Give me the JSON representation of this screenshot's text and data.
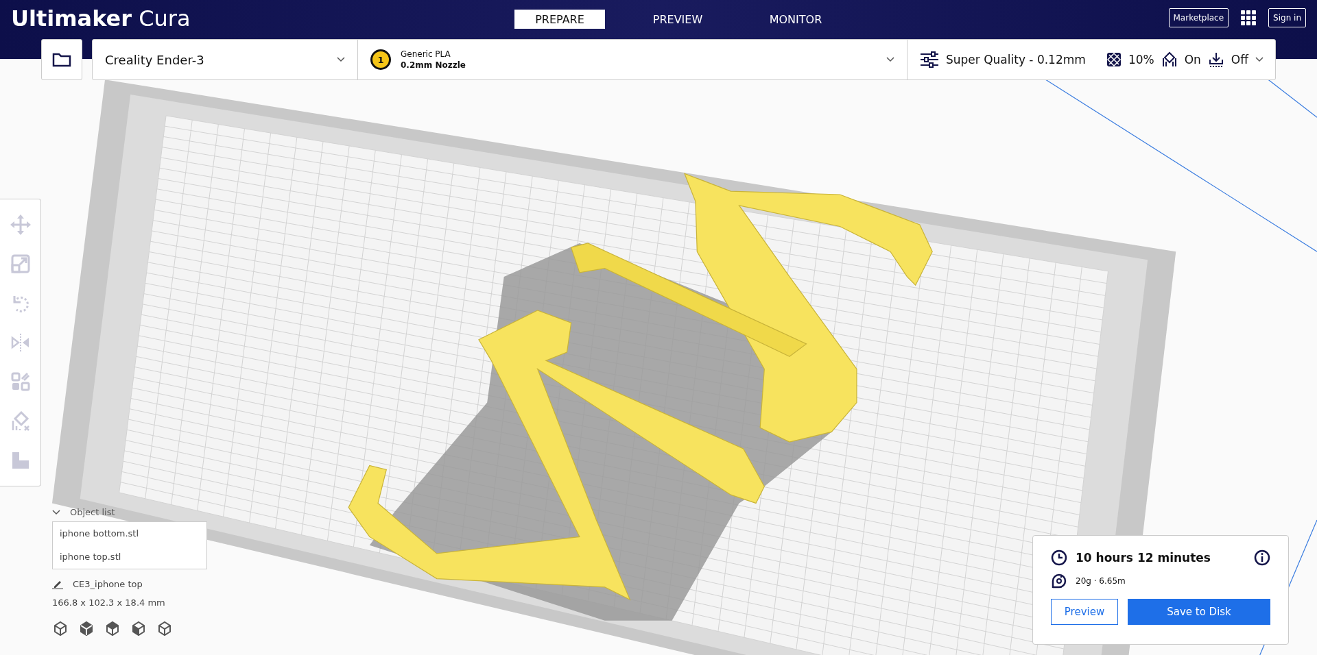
{
  "header": {
    "logo": {
      "brand": "Ultimaker",
      "product": "Cura"
    },
    "tabs": [
      {
        "label": "PREPARE",
        "selected": true
      },
      {
        "label": "PREVIEW",
        "selected": false
      },
      {
        "label": "MONITOR",
        "selected": false
      }
    ],
    "buttons": [
      "Marketplace",
      "Sign in"
    ]
  },
  "toolbar": {
    "printer": "Creality Ender-3",
    "extruder": {
      "number": "1",
      "material": "Generic PLA",
      "nozzle": "0.2mm Nozzle"
    },
    "settings": {
      "profile": "Super Quality - 0.12mm",
      "infill": "10%",
      "support": "On",
      "adhesion": "Off"
    }
  },
  "object_list": {
    "title": "Object list",
    "expanded": true,
    "items": [
      "iphone bottom.stl",
      "iphone top.stl"
    ],
    "job_name": "CE3_iphone top",
    "dimensions": "166.8 x 102.3 x 18.4 mm"
  },
  "print_summary": {
    "time": "10 hours 12 minutes",
    "material": "20g · 6.65m",
    "buttons": [
      {
        "label": "Preview",
        "kind": "outline"
      },
      {
        "label": "Save to Disk",
        "kind": "primary"
      }
    ]
  }
}
